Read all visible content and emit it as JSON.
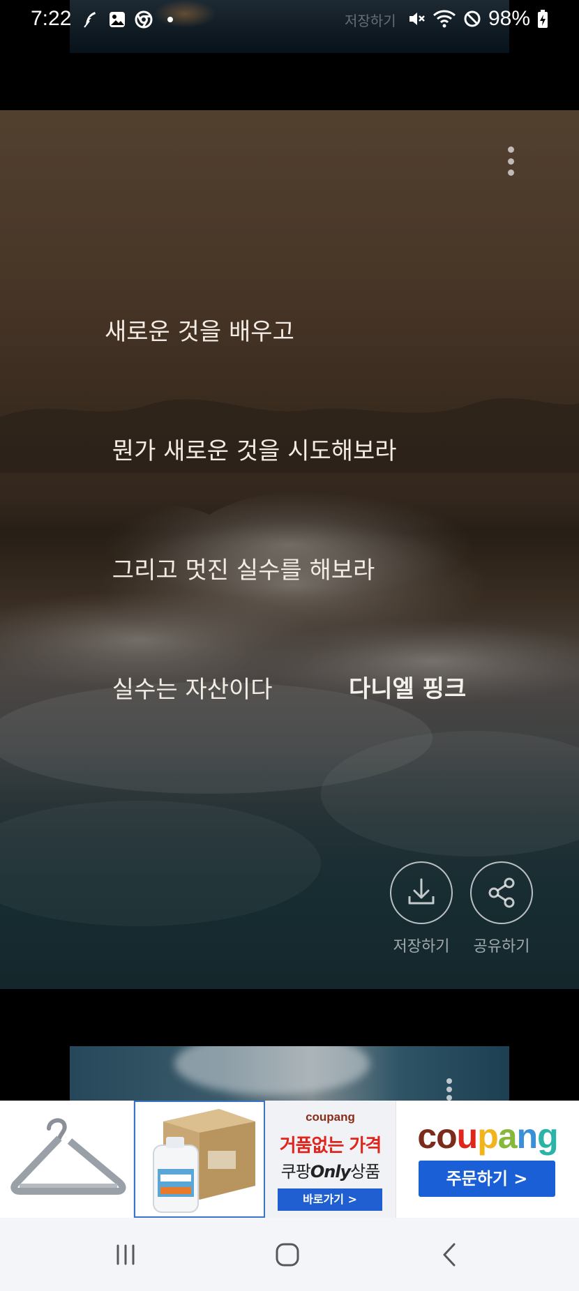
{
  "status_bar": {
    "time": "7:22",
    "ghost_text": "저장하기",
    "battery": "98%"
  },
  "card": {
    "quote_lines": [
      "새로운 것을 배우고",
      " 뭔가 새로운 것을 시도해보라",
      " 그리고 멋진 실수를 해보라",
      " 실수는 자산이다"
    ],
    "author": "다니엘 핑크",
    "save_label": "저장하기",
    "share_label": "공유하기"
  },
  "ad": {
    "tile3_logo": "coupang",
    "tile3_headline": "거품없는 가격",
    "tile3_sub_prefix": "쿠팡",
    "tile3_sub_only": "Only",
    "tile3_sub_suffix": "상품",
    "tile3_button": "바로가기 >",
    "tile4_logo": "coupang",
    "tile4_button": "주문하기 >",
    "colors": {
      "coupang_blue": "#1a5fd6",
      "headline_red": "#e0261c"
    }
  },
  "nav": {
    "recent": "recent-apps",
    "home": "home",
    "back": "back"
  }
}
